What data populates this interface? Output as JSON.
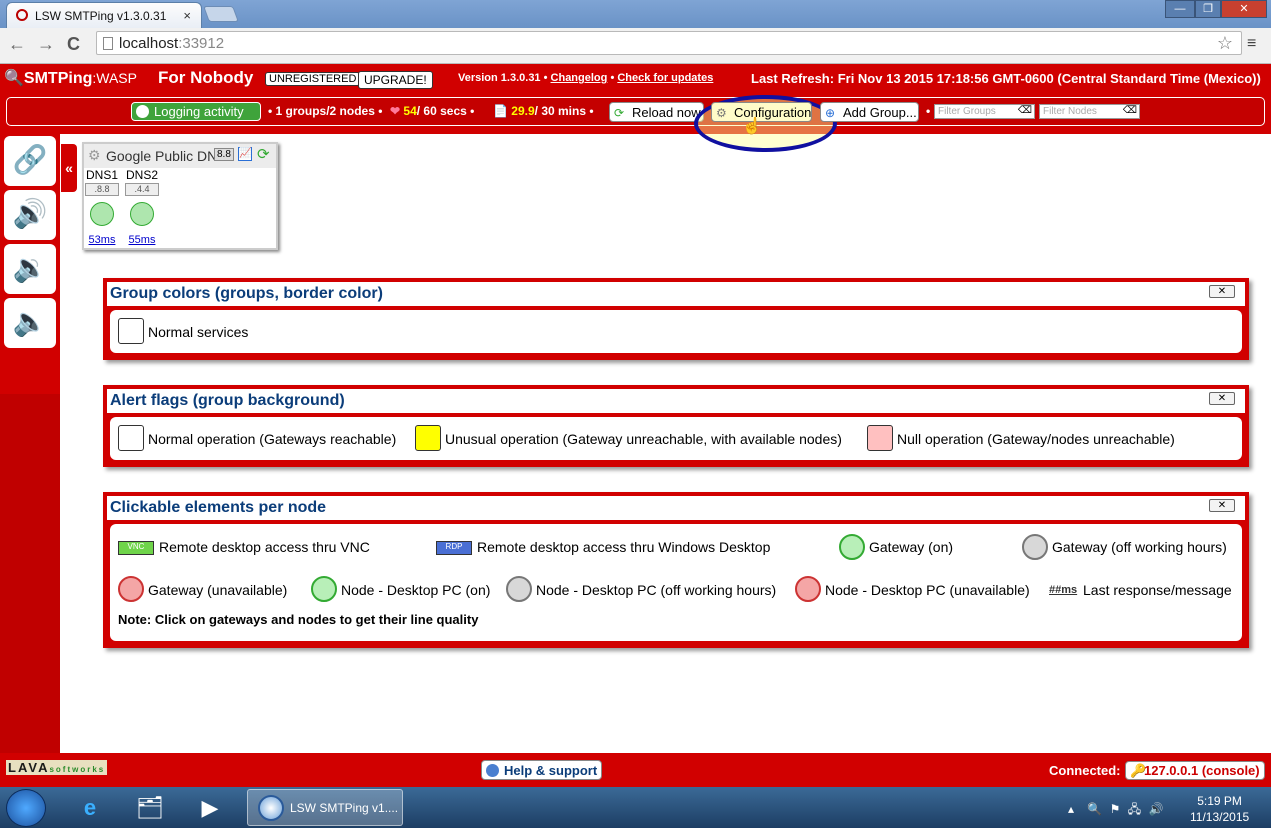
{
  "browser": {
    "tab_title": "LSW SMTPing v1.3.0.31",
    "tab_close": "×",
    "url_host": "localhost",
    "url_port": ":33912",
    "star": "☆",
    "menu": "≡",
    "back": "←",
    "forward": "→",
    "reload": "C",
    "win_min": "—",
    "win_max": "❐",
    "win_close": "✕"
  },
  "app": {
    "brand": "SMTPing",
    "brand_suffix": ":WASP",
    "user": "For Nobody",
    "unregistered": "UNREGISTERED",
    "upgrade": "UPGRADE!",
    "version_text": "Version 1.3.0.31 •",
    "changelog": "Changelog",
    "dot": "•",
    "check_updates": "Check for updates",
    "last_refresh": "Last Refresh: Fri Nov 13 2015 17:18:56 GMT-0600 (Central Standard Time (Mexico))"
  },
  "statusbar": {
    "logging": "Logging activity",
    "groups_nodes": "• 1 groups/2 nodes •",
    "heart_val": "54",
    "heart_total": "/ 60 secs •",
    "mins_val": "29.9",
    "mins_total": "/ 30 mins •",
    "reload": "Reload now",
    "configuration": "Configuration",
    "add_group": "Add Group...",
    "sep": "•",
    "filter_groups": "Filter Groups",
    "filter_nodes": "Filter Nodes"
  },
  "sidebar": {
    "collapse": "«"
  },
  "group": {
    "name": "Google Public DNSs",
    "badge": "8.8",
    "nodes": [
      {
        "name": "DNS1",
        "ip": ".8.8",
        "ms": "53ms"
      },
      {
        "name": "DNS2",
        "ip": ".4.4",
        "ms": "55ms"
      }
    ]
  },
  "legend": {
    "group_colors": {
      "title": "Group colors (groups, border color)",
      "items": [
        "Normal services"
      ]
    },
    "alert_flags": {
      "title": "Alert flags (group background)",
      "items": [
        {
          "label": "Normal operation (Gateways reachable)",
          "color": "#ffffff"
        },
        {
          "label": "Unusual operation (Gateway unreachable, with available nodes)",
          "color": "#ffff00"
        },
        {
          "label": "Null operation (Gateway/nodes unreachable)",
          "color": "#ffc0c0"
        }
      ]
    },
    "clickable": {
      "title": "Clickable elements per node",
      "vnc": "Remote desktop access thru VNC",
      "vnc_badge": "VNC",
      "rdp": "Remote desktop access thru Windows Desktop",
      "rdp_badge": "RDP",
      "gw_on": "Gateway (on)",
      "gw_off": "Gateway (off working hours)",
      "gw_unavail": "Gateway (unavailable)",
      "node_on": "Node - Desktop PC (on)",
      "node_off": "Node - Desktop PC (off working hours)",
      "node_unavail": "Node - Desktop PC (unavailable)",
      "ms_sample": "##ms",
      "ms_label": "Last response/message",
      "note": "Note: Click on gateways and nodes to get their line quality"
    },
    "close": "✕"
  },
  "footer": {
    "logo": "LAVA",
    "logo_sub": "softworks",
    "help": "Help & support",
    "connected": "Connected:",
    "ip": "127.0.0.1 (console)"
  },
  "taskbar": {
    "app": "LSW SMTPing v1....",
    "time": "5:19 PM",
    "date": "11/13/2015"
  },
  "colors": {
    "brand_red": "#d10000",
    "accent_blue": "#0b3d7a",
    "ok_green": "#3fa33b"
  }
}
